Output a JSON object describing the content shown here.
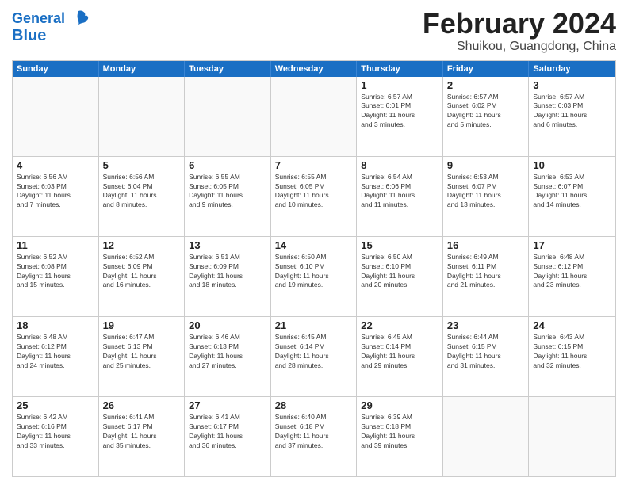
{
  "header": {
    "logo": {
      "line1": "General",
      "line2": "Blue"
    },
    "title": "February 2024",
    "subtitle": "Shuikou, Guangdong, China"
  },
  "days": [
    "Sunday",
    "Monday",
    "Tuesday",
    "Wednesday",
    "Thursday",
    "Friday",
    "Saturday"
  ],
  "weeks": [
    [
      {
        "day": "",
        "info": ""
      },
      {
        "day": "",
        "info": ""
      },
      {
        "day": "",
        "info": ""
      },
      {
        "day": "",
        "info": ""
      },
      {
        "day": "1",
        "info": "Sunrise: 6:57 AM\nSunset: 6:01 PM\nDaylight: 11 hours\nand 3 minutes."
      },
      {
        "day": "2",
        "info": "Sunrise: 6:57 AM\nSunset: 6:02 PM\nDaylight: 11 hours\nand 5 minutes."
      },
      {
        "day": "3",
        "info": "Sunrise: 6:57 AM\nSunset: 6:03 PM\nDaylight: 11 hours\nand 6 minutes."
      }
    ],
    [
      {
        "day": "4",
        "info": "Sunrise: 6:56 AM\nSunset: 6:03 PM\nDaylight: 11 hours\nand 7 minutes."
      },
      {
        "day": "5",
        "info": "Sunrise: 6:56 AM\nSunset: 6:04 PM\nDaylight: 11 hours\nand 8 minutes."
      },
      {
        "day": "6",
        "info": "Sunrise: 6:55 AM\nSunset: 6:05 PM\nDaylight: 11 hours\nand 9 minutes."
      },
      {
        "day": "7",
        "info": "Sunrise: 6:55 AM\nSunset: 6:05 PM\nDaylight: 11 hours\nand 10 minutes."
      },
      {
        "day": "8",
        "info": "Sunrise: 6:54 AM\nSunset: 6:06 PM\nDaylight: 11 hours\nand 11 minutes."
      },
      {
        "day": "9",
        "info": "Sunrise: 6:53 AM\nSunset: 6:07 PM\nDaylight: 11 hours\nand 13 minutes."
      },
      {
        "day": "10",
        "info": "Sunrise: 6:53 AM\nSunset: 6:07 PM\nDaylight: 11 hours\nand 14 minutes."
      }
    ],
    [
      {
        "day": "11",
        "info": "Sunrise: 6:52 AM\nSunset: 6:08 PM\nDaylight: 11 hours\nand 15 minutes."
      },
      {
        "day": "12",
        "info": "Sunrise: 6:52 AM\nSunset: 6:09 PM\nDaylight: 11 hours\nand 16 minutes."
      },
      {
        "day": "13",
        "info": "Sunrise: 6:51 AM\nSunset: 6:09 PM\nDaylight: 11 hours\nand 18 minutes."
      },
      {
        "day": "14",
        "info": "Sunrise: 6:50 AM\nSunset: 6:10 PM\nDaylight: 11 hours\nand 19 minutes."
      },
      {
        "day": "15",
        "info": "Sunrise: 6:50 AM\nSunset: 6:10 PM\nDaylight: 11 hours\nand 20 minutes."
      },
      {
        "day": "16",
        "info": "Sunrise: 6:49 AM\nSunset: 6:11 PM\nDaylight: 11 hours\nand 21 minutes."
      },
      {
        "day": "17",
        "info": "Sunrise: 6:48 AM\nSunset: 6:12 PM\nDaylight: 11 hours\nand 23 minutes."
      }
    ],
    [
      {
        "day": "18",
        "info": "Sunrise: 6:48 AM\nSunset: 6:12 PM\nDaylight: 11 hours\nand 24 minutes."
      },
      {
        "day": "19",
        "info": "Sunrise: 6:47 AM\nSunset: 6:13 PM\nDaylight: 11 hours\nand 25 minutes."
      },
      {
        "day": "20",
        "info": "Sunrise: 6:46 AM\nSunset: 6:13 PM\nDaylight: 11 hours\nand 27 minutes."
      },
      {
        "day": "21",
        "info": "Sunrise: 6:45 AM\nSunset: 6:14 PM\nDaylight: 11 hours\nand 28 minutes."
      },
      {
        "day": "22",
        "info": "Sunrise: 6:45 AM\nSunset: 6:14 PM\nDaylight: 11 hours\nand 29 minutes."
      },
      {
        "day": "23",
        "info": "Sunrise: 6:44 AM\nSunset: 6:15 PM\nDaylight: 11 hours\nand 31 minutes."
      },
      {
        "day": "24",
        "info": "Sunrise: 6:43 AM\nSunset: 6:15 PM\nDaylight: 11 hours\nand 32 minutes."
      }
    ],
    [
      {
        "day": "25",
        "info": "Sunrise: 6:42 AM\nSunset: 6:16 PM\nDaylight: 11 hours\nand 33 minutes."
      },
      {
        "day": "26",
        "info": "Sunrise: 6:41 AM\nSunset: 6:17 PM\nDaylight: 11 hours\nand 35 minutes."
      },
      {
        "day": "27",
        "info": "Sunrise: 6:41 AM\nSunset: 6:17 PM\nDaylight: 11 hours\nand 36 minutes."
      },
      {
        "day": "28",
        "info": "Sunrise: 6:40 AM\nSunset: 6:18 PM\nDaylight: 11 hours\nand 37 minutes."
      },
      {
        "day": "29",
        "info": "Sunrise: 6:39 AM\nSunset: 6:18 PM\nDaylight: 11 hours\nand 39 minutes."
      },
      {
        "day": "",
        "info": ""
      },
      {
        "day": "",
        "info": ""
      }
    ]
  ]
}
